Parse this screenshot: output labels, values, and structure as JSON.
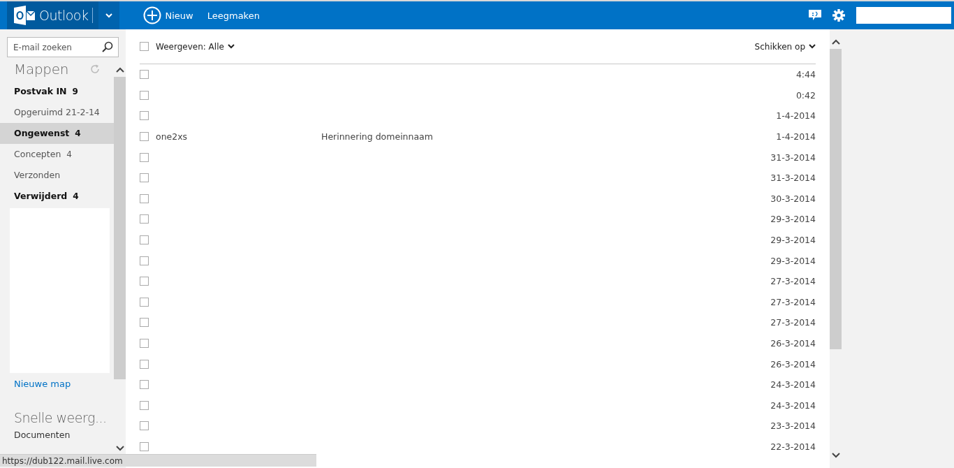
{
  "header": {
    "app_name": "Outlook",
    "actions": [
      {
        "kind": "new",
        "label": "Nieuw"
      },
      {
        "kind": "plain",
        "label": "Leegmaken"
      }
    ]
  },
  "sidebar": {
    "search": {
      "placeholder": "E-mail zoeken"
    },
    "folders_title": "Mappen",
    "folders": [
      {
        "name": "Postvak IN",
        "count": "9",
        "unread": true,
        "selected": false
      },
      {
        "name": "Opgeruimd 21-2-14",
        "unread": false,
        "selected": false
      },
      {
        "name": "Ongewenst",
        "count": "4",
        "unread": true,
        "selected": true
      },
      {
        "name": "Concepten",
        "count": "4",
        "unread": false,
        "selected": false
      },
      {
        "name": "Verzonden",
        "unread": false,
        "selected": false
      },
      {
        "name": "Verwijderd",
        "count": "4",
        "unread": true,
        "selected": false
      }
    ],
    "new_folder": "Nieuwe map",
    "quick_views_title": "Snelle weerg...",
    "quick_views": [
      "Documenten"
    ]
  },
  "message_list": {
    "filter": "Weergeven: Alle",
    "sort": "Schikken op",
    "select_all_checked": false,
    "messages": [
      {
        "date": "4:44",
        "checked": false
      },
      {
        "date": "0:42",
        "checked": false
      },
      {
        "date": "1-4-2014",
        "checked": false
      },
      {
        "sender": "one2xs",
        "subject": "Herinnering domeinnaam",
        "date": "1-4-2014",
        "checked": false
      },
      {
        "date": "31-3-2014",
        "checked": false
      },
      {
        "date": "31-3-2014",
        "checked": false
      },
      {
        "date": "30-3-2014",
        "checked": false
      },
      {
        "date": "29-3-2014",
        "checked": false
      },
      {
        "date": "29-3-2014",
        "checked": false
      },
      {
        "date": "29-3-2014",
        "checked": false
      },
      {
        "date": "27-3-2014",
        "checked": false
      },
      {
        "date": "27-3-2014",
        "checked": false
      },
      {
        "date": "27-3-2014",
        "checked": false
      },
      {
        "date": "26-3-2014",
        "checked": false
      },
      {
        "date": "26-3-2014",
        "checked": false
      },
      {
        "date": "24-3-2014",
        "checked": false
      },
      {
        "date": "24-3-2014",
        "checked": false
      },
      {
        "date": "23-3-2014",
        "checked": false
      },
      {
        "date": "22-3-2014",
        "checked": false
      }
    ]
  },
  "status_bar": {
    "url": "https://dub122.mail.live.com"
  }
}
